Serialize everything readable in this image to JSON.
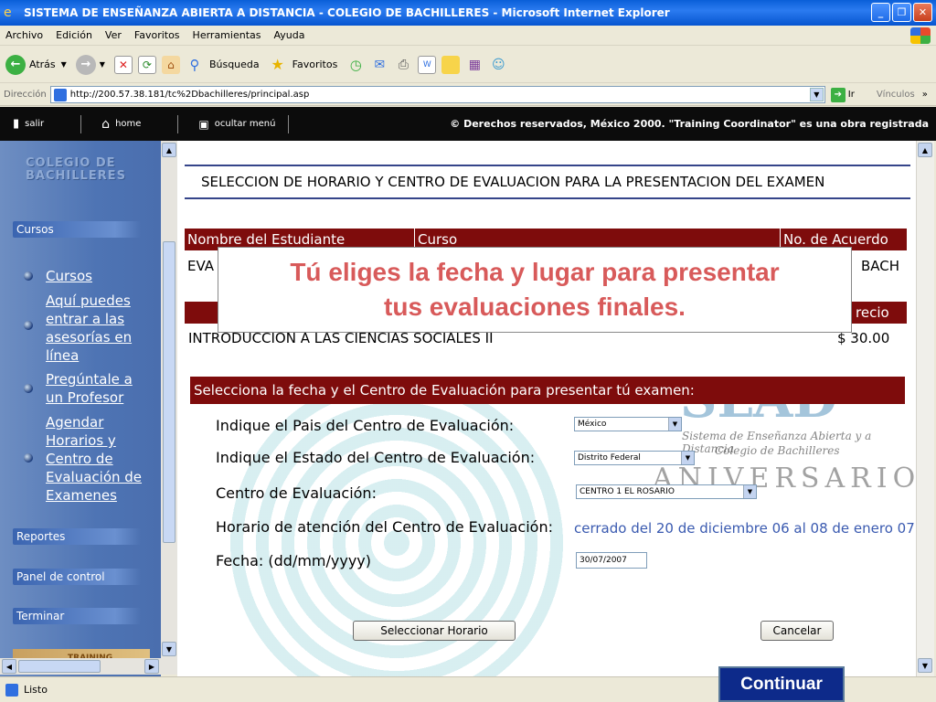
{
  "window": {
    "title": "SISTEMA DE ENSEÑANZA ABIERTA A DISTANCIA - COLEGIO DE BACHILLERES - Microsoft Internet Explorer",
    "minimize_label": "_",
    "maximize_label": "❐",
    "close_label": "✕"
  },
  "menu": [
    "Archivo",
    "Edición",
    "Ver",
    "Favoritos",
    "Herramientas",
    "Ayuda"
  ],
  "toolbar": {
    "back_label": "Atrás",
    "search_label": "Búsqueda",
    "favorites_label": "Favoritos"
  },
  "address": {
    "label": "Dirección",
    "url": "http://200.57.38.181/tc%2Dbachilleres/principal.asp",
    "go_label": "Ir",
    "links_label": "Vínculos"
  },
  "site_header": {
    "exit_label": "salir",
    "home_label": "home",
    "hide_menu_label": "ocultar menú",
    "copyright": "© Derechos reservados, México 2000. \"Training Coordinator\" es una obra registrada"
  },
  "sidebar": {
    "logo_line1": "COLEGIO DE",
    "logo_line2": "BACHILLERES",
    "section_cursos": "Cursos",
    "links": [
      "Cursos",
      "Aquí puedes entrar a las asesorías en línea",
      "Pregúntale a un Profesor",
      "Agendar Horarios y Centro de Evaluación de Examenes"
    ],
    "section_reportes": "Reportes",
    "section_panel": "Panel de control",
    "section_terminar": "Terminar",
    "training_label": "TRAINING"
  },
  "main": {
    "heading": "SELECCION DE HORARIO Y CENTRO DE EVALUACION PARA LA PRESENTACION DEL EXAMEN",
    "table": {
      "col_student": "Nombre del Estudiante",
      "col_course": "Curso",
      "col_agreement": "No. de Acuerdo",
      "student_value": "EVA",
      "agreement_value": "BACH",
      "col_price": "recio",
      "course_name": "INTRODUCCION A LAS CIENCIAS SOCIALES II",
      "price_value": "$ 30.00"
    },
    "section_title": "Selecciona la fecha y el Centro de Evaluación para presentar tú examen:",
    "form": {
      "country_label": "Indique el Pais del Centro de Evaluación:",
      "country_value": "México",
      "state_label": "Indique el Estado del Centro de Evaluación:",
      "state_value": "Distrito Federal",
      "center_label": "Centro de Evaluación:",
      "center_value": "CENTRO 1 EL ROSARIO",
      "schedule_label": "Horario de atención del Centro de Evaluación:",
      "schedule_value": "cerrado del 20 de diciembre 06 al 08 de enero 07",
      "date_label": "Fecha: (dd/mm/yyyy)",
      "date_value": "30/07/2007"
    },
    "select_button": "Seleccionar Horario",
    "cancel_button": "Cancelar",
    "watermark": {
      "brand": "SLAD",
      "line1": "Sistema de Enseñanza Abierta y a Distancia",
      "line2": "Colegio de Bachilleres",
      "aniversario": "ANIVERSARIO"
    }
  },
  "callout": {
    "line1": "Tú eliges la fecha y lugar para presentar",
    "line2": "tus evaluaciones finales."
  },
  "status": {
    "text": "Listo"
  },
  "continue_button": "Continuar"
}
